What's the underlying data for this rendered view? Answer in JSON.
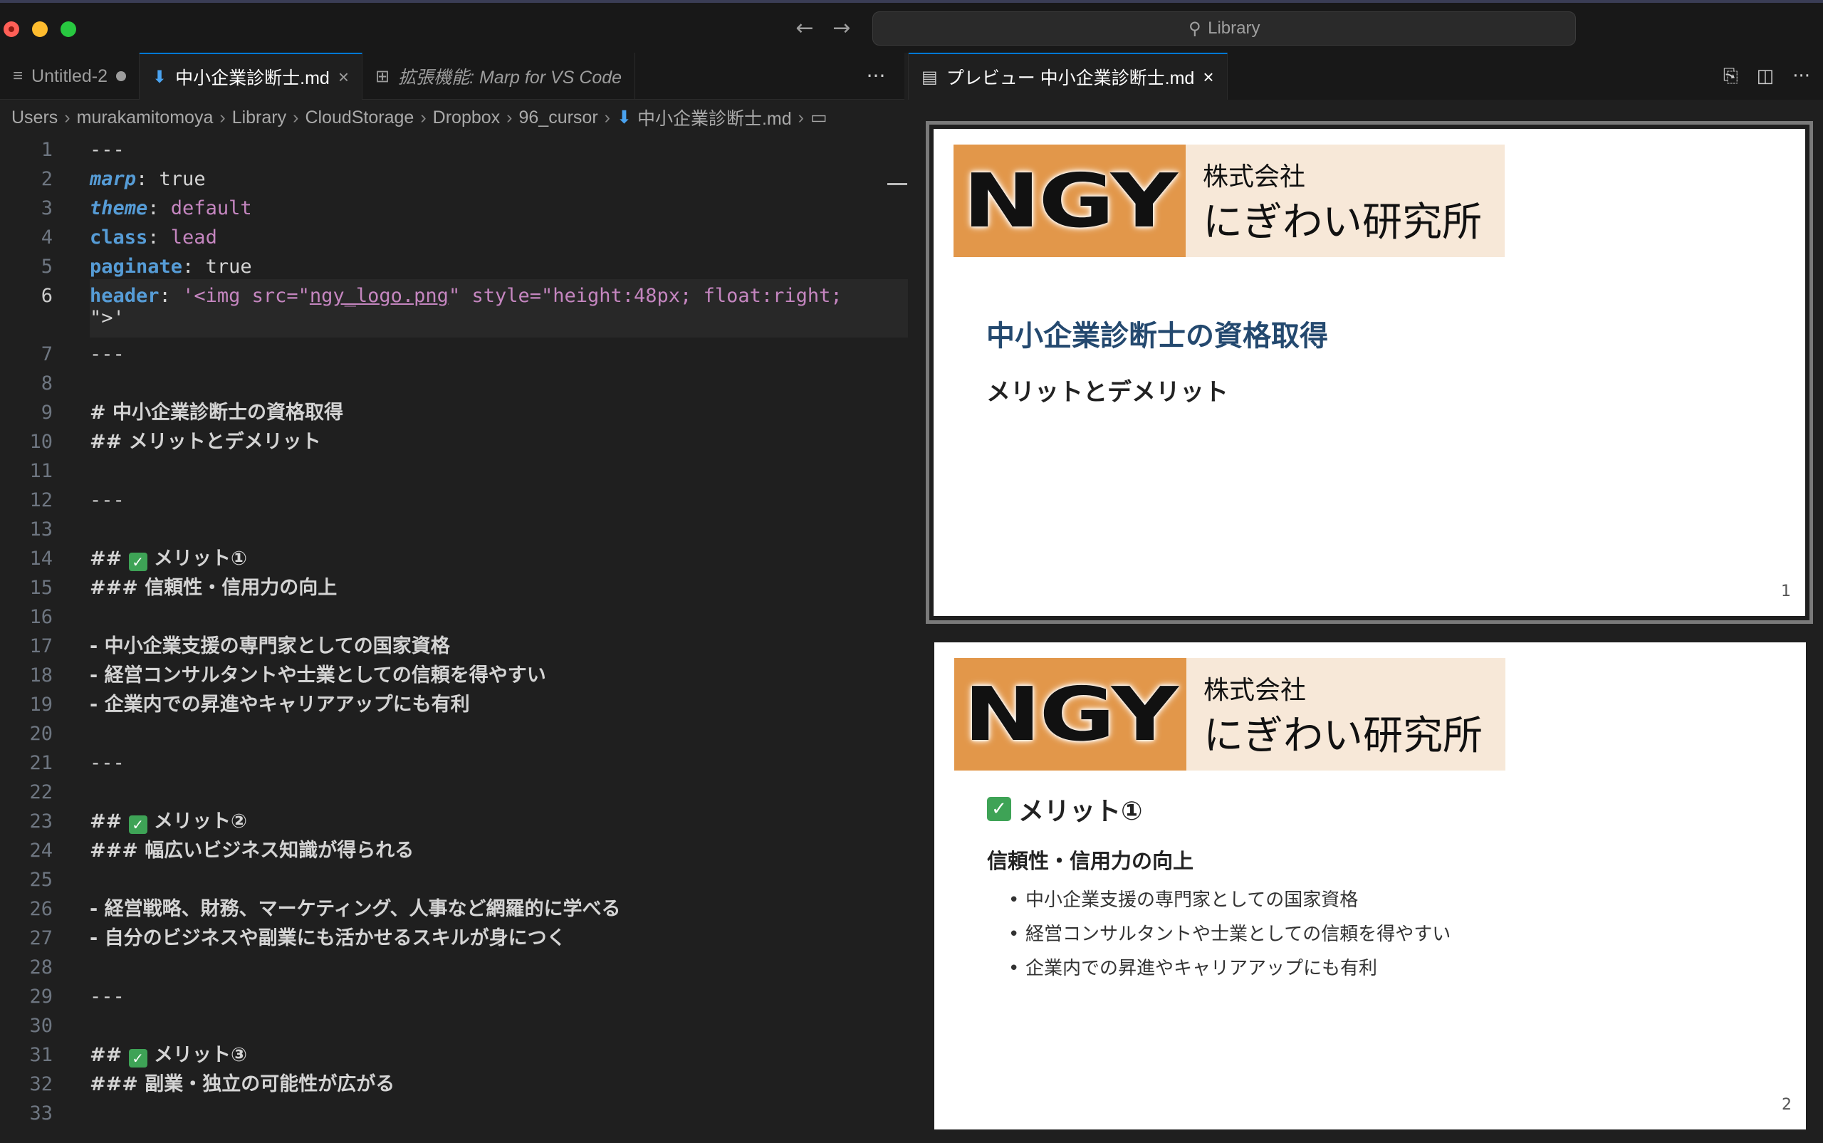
{
  "window": {
    "search_text": "Library"
  },
  "editor_tabs": [
    {
      "label": "Untitled-2",
      "state": "modified"
    },
    {
      "label": "中小企業診断士.md",
      "state": "active"
    },
    {
      "label": "拡張機能: Marp for VS Code",
      "state": "preview"
    }
  ],
  "breadcrumb": [
    "Users",
    "murakamitomoya",
    "Library",
    "CloudStorage",
    "Dropbox",
    "96_cursor",
    "中小企業診断士.md"
  ],
  "preview_tab": {
    "label": "プレビュー 中小企業診断士.md"
  },
  "code": {
    "line_numbers": [
      "1",
      "2",
      "3",
      "4",
      "5",
      "6",
      "7",
      "8",
      "9",
      "10",
      "11",
      "12",
      "13",
      "14",
      "15",
      "16",
      "17",
      "18",
      "19",
      "20",
      "21",
      "22",
      "23",
      "24",
      "25",
      "26",
      "27",
      "28",
      "29",
      "30",
      "31",
      "32",
      "33"
    ],
    "active_line": "6",
    "fm_sep": "---",
    "marp_key": "marp",
    "marp_val": "true",
    "theme_key": "theme",
    "theme_val": "default",
    "class_key": "class",
    "class_val": "lead",
    "paginate_key": "paginate",
    "paginate_val": "true",
    "header_key": "header",
    "header_val_a": "'<img src=\"",
    "header_val_url": "ngy_logo.png",
    "header_val_b": "\" style=\"height:48px; float:right;",
    "header_val_c": "\">'",
    "l9": "# 中小企業診断士の資格取得",
    "l10": "## メリットとデメリット",
    "l14_prefix": "## ",
    "l14_text": " メリット①",
    "l15": "### 信頼性・信用力の向上",
    "l17": "- 中小企業支援の専門家としての国家資格",
    "l18": "- 経営コンサルタントや士業としての信頼を得やすい",
    "l19": "- 企業内での昇進やキャリアアップにも有利",
    "l23_prefix": "## ",
    "l23_text": " メリット②",
    "l24": "### 幅広いビジネス知識が得られる",
    "l26": "- 経営戦略、財務、マーケティング、人事など網羅的に学べる",
    "l27": "- 自分のビジネスや副業にも活かせるスキルが身につく",
    "l31_prefix": "## ",
    "l31_text": " メリット③",
    "l32": "### 副業・独立の可能性が広がる",
    "check_glyph": "✓"
  },
  "slides": {
    "logo_text": "NGY",
    "company_line1": "株式会社",
    "company_line2": "にぎわい研究所",
    "slide1": {
      "title": "中小企業診断士の資格取得",
      "subtitle": "メリットとデメリット",
      "page": "1"
    },
    "slide2": {
      "heading": "メリット①",
      "subheading": "信頼性・信用力の向上",
      "bullets": [
        "中小企業支援の専門家としての国家資格",
        "経営コンサルタントや士業としての信頼を得やすい",
        "企業内での昇進やキャリアアップにも有利"
      ],
      "page": "2"
    }
  },
  "colors": {
    "logo_orange": "#e2974a",
    "logo_cream": "#f7e8d8",
    "title_blue": "#24496f",
    "accent": "#0078d4"
  }
}
